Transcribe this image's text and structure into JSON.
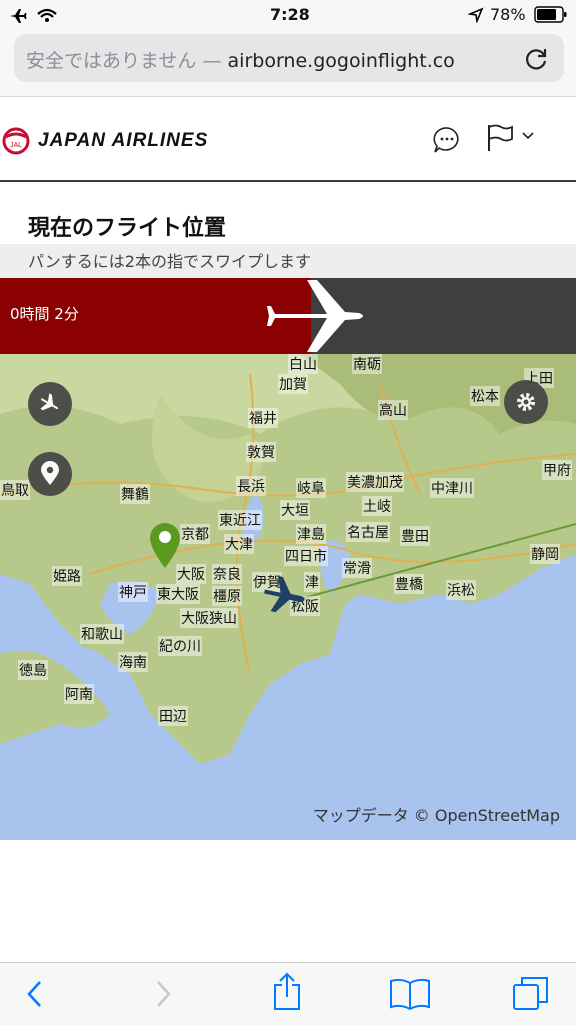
{
  "status_bar": {
    "time": "7:28",
    "battery": "78%"
  },
  "browser": {
    "url_warning": "安全ではありません —",
    "url_host": "airborne.gogoinflight.co"
  },
  "header": {
    "brand": "JAPAN AIRLINES",
    "icons": [
      "chat-icon",
      "flag-icon",
      "chevron-down-icon"
    ]
  },
  "page": {
    "title": "現在のフライト位置",
    "swipe_hint": "パンするには2本の指でスワイプします"
  },
  "flight": {
    "time_remaining": "0時間 2分",
    "progress_fraction": 0.54
  },
  "map": {
    "attribution": "マップデータ © OpenStreetMap",
    "places": [
      "白山",
      "南砺",
      "上田",
      "加賀",
      "松本",
      "高山",
      "福井",
      "敦賀",
      "長浜",
      "岐阜",
      "美濃加茂",
      "中津川",
      "甲府",
      "舞鶴",
      "大垣",
      "土岐",
      "鳥取",
      "東近江",
      "京都",
      "大津",
      "名古屋",
      "豊田",
      "津島",
      "静岡",
      "四日市",
      "大阪",
      "奈良",
      "伊賀",
      "津",
      "常滑",
      "姫路",
      "神戸",
      "東大阪",
      "橿原",
      "豊橋",
      "浜松",
      "大阪狭山",
      "松阪",
      "和歌山",
      "紀の川",
      "海南",
      "徳島",
      "阿南",
      "田辺"
    ]
  },
  "colors": {
    "brand_red": "#c8102e",
    "progress_fill": "#8b0000",
    "progress_track": "#3f3f3f",
    "ios_blue": "#007aff",
    "origin_pin": "#5a9a1f",
    "aircraft": "#1f3f66"
  }
}
